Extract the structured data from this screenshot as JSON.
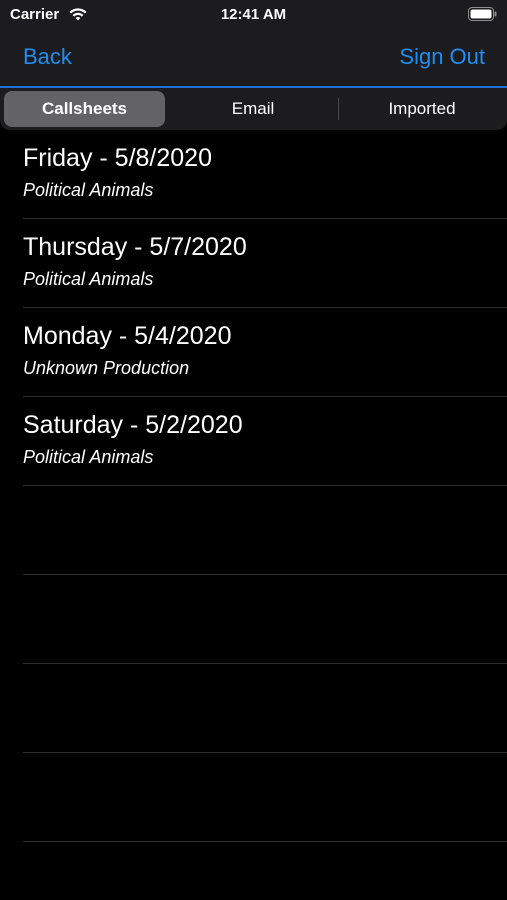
{
  "status_bar": {
    "carrier": "Carrier",
    "time": "12:41 AM",
    "wifi_icon": "wifi-icon",
    "battery_icon": "battery-icon"
  },
  "nav": {
    "back_label": "Back",
    "sign_out_label": "Sign Out"
  },
  "segments": {
    "items": [
      {
        "label": "Callsheets",
        "selected": true
      },
      {
        "label": "Email",
        "selected": false
      },
      {
        "label": "Imported",
        "selected": false
      }
    ]
  },
  "callsheets": [
    {
      "title": "Friday - 5/8/2020",
      "production": "Political Animals"
    },
    {
      "title": "Thursday - 5/7/2020",
      "production": "Political Animals"
    },
    {
      "title": "Monday - 5/4/2020",
      "production": "Unknown Production"
    },
    {
      "title": "Saturday - 5/2/2020",
      "production": "Political Animals"
    }
  ],
  "colors": {
    "accent": "#1f8ef1",
    "background": "#000000",
    "bar": "#1c1c1e",
    "selected_segment": "#636366"
  }
}
